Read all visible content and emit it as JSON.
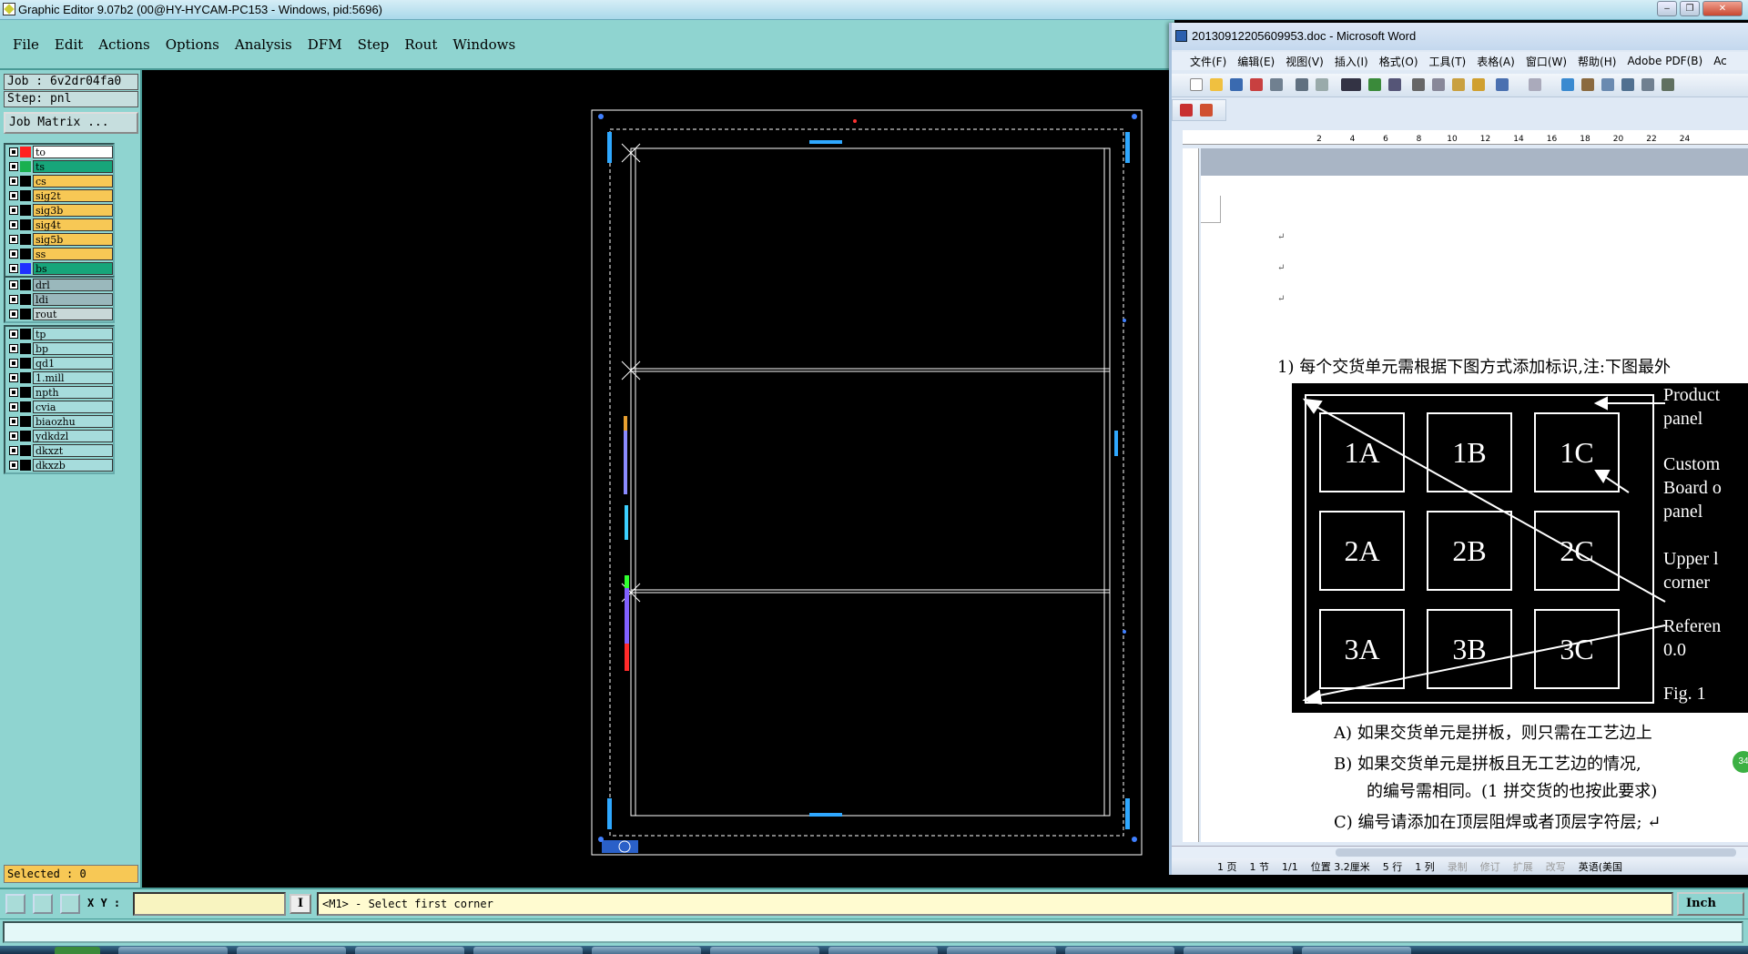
{
  "genesis": {
    "window_title": "Graphic Editor 9.07b2 (00@HY-HYCAM-PC153 - Windows, pid:5696)",
    "menus": [
      "File",
      "Edit",
      "Actions",
      "Options",
      "Analysis",
      "DFM",
      "Step",
      "Rout",
      "Windows"
    ],
    "job_label": "Job : 6v2dr04fa0",
    "step_label": "Step: pnl",
    "job_matrix_button": "Job Matrix ...",
    "layer_groups": [
      [
        {
          "name": "to",
          "swatch": "#ff2020",
          "fill": "#ffffff"
        },
        {
          "name": "ts",
          "swatch": "#1ab050",
          "fill": "#17a57a"
        },
        {
          "name": "cs",
          "swatch": "#000000",
          "fill": "#f7c855"
        },
        {
          "name": "sig2t",
          "swatch": "#000000",
          "fill": "#f7c855"
        },
        {
          "name": "sig3b",
          "swatch": "#000000",
          "fill": "#f7c855"
        },
        {
          "name": "sig4t",
          "swatch": "#000000",
          "fill": "#f7c855"
        },
        {
          "name": "sig5b",
          "swatch": "#000000",
          "fill": "#f7c855"
        },
        {
          "name": "ss",
          "swatch": "#000000",
          "fill": "#f7c855"
        },
        {
          "name": "bs",
          "swatch": "#2030ff",
          "fill": "#17a57a"
        }
      ],
      [
        {
          "name": "drl",
          "swatch": "#000000",
          "fill": "#9ab8bc"
        },
        {
          "name": "ldi",
          "swatch": "#000000",
          "fill": "#9ab8bc"
        },
        {
          "name": "rout",
          "swatch": "#000000",
          "fill": "#c8d8d8"
        }
      ],
      [
        {
          "name": "tp",
          "swatch": "#000000",
          "fill": "#a6dcdc"
        },
        {
          "name": "bp",
          "swatch": "#000000",
          "fill": "#a6dcdc"
        },
        {
          "name": "qd1",
          "swatch": "#000000",
          "fill": "#a6dcdc"
        },
        {
          "name": "1.mill",
          "swatch": "#000000",
          "fill": "#a6dcdc"
        },
        {
          "name": "npth",
          "swatch": "#000000",
          "fill": "#a6dcdc"
        },
        {
          "name": "cvia",
          "swatch": "#000000",
          "fill": "#a6dcdc"
        },
        {
          "name": "biaozhu",
          "swatch": "#000000",
          "fill": "#a6dcdc"
        },
        {
          "name": "ydkdzl",
          "swatch": "#000000",
          "fill": "#a6dcdc"
        },
        {
          "name": "dkxzt",
          "swatch": "#000000",
          "fill": "#a6dcdc"
        },
        {
          "name": "dkxzb",
          "swatch": "#000000",
          "fill": "#a6dcdc"
        }
      ]
    ],
    "selected_label": "Selected : 0",
    "xy_label": "X Y :",
    "xy_value": "",
    "help_button": "I",
    "prompt": "<M1> - Select first corner",
    "units": "Inch"
  },
  "word": {
    "window_title": "20130912205609953.doc - Microsoft Word",
    "menus": [
      "文件(F)",
      "编辑(E)",
      "视图(V)",
      "插入(I)",
      "格式(O)",
      "工具(T)",
      "表格(A)",
      "窗口(W)",
      "帮助(H)",
      "Adobe PDF(B)",
      "Ac"
    ],
    "ruler_ticks": [
      "2",
      "4",
      "6",
      "8",
      "10",
      "12",
      "14",
      "16",
      "18",
      "20",
      "22",
      "24"
    ],
    "para_marks": [
      "↵",
      "↵",
      "↵"
    ],
    "item1": "1)  每个交货单元需根据下图方式添加标识,注:下图最外",
    "figure": {
      "cells": [
        "1A",
        "1B",
        "1C",
        "2A",
        "2B",
        "2C",
        "3A",
        "3B",
        "3C"
      ],
      "labels": [
        "Product\npanel",
        "Custom\nBoard o\npanel",
        "Upper l\ncorner",
        "Referen\n0.0",
        "Fig. 1"
      ]
    },
    "itemA": "A)  如果交货单元是拼板，则只需在工艺边上",
    "itemB": "B)  如果交货单元是拼板且无工艺边的情况,",
    "itemB2": "的编号需相同。(1 拼交货的也按此要求)",
    "itemC": "C)  编号请添加在顶层阻焊或者顶层字符层; ↵",
    "badge": "34",
    "status": [
      "1 页",
      "1 节",
      "1/1",
      "位置 3.2厘米",
      "5 行",
      "1 列",
      "录制",
      "修订",
      "扩展",
      "改写",
      "英语(美国"
    ]
  }
}
